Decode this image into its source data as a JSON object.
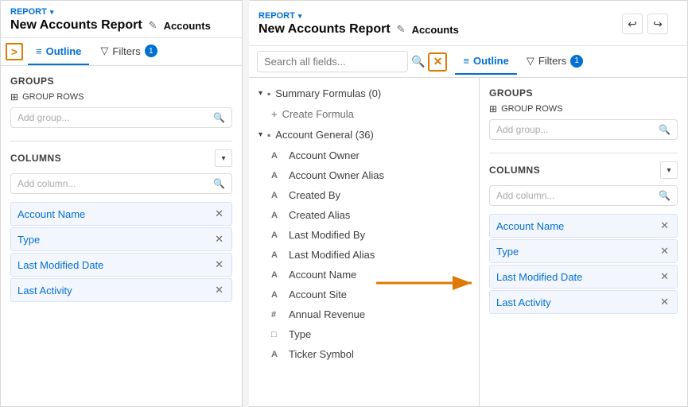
{
  "left": {
    "report_label": "REPORT",
    "title": "New Accounts Report",
    "accounts": "Accounts",
    "tabs": {
      "outline": "Outline",
      "filters": "Filters",
      "filters_count": "1"
    },
    "expand_icon": ">",
    "groups": {
      "title": "Groups",
      "group_rows_label": "GROUP ROWS",
      "placeholder": "Add group..."
    },
    "columns": {
      "title": "Columns",
      "placeholder": "Add column...",
      "items": [
        {
          "label": "Account Name"
        },
        {
          "label": "Type"
        },
        {
          "label": "Last Modified Date"
        },
        {
          "label": "Last Activity"
        }
      ]
    }
  },
  "right": {
    "report_label": "REPORT",
    "title": "New Accounts Report",
    "accounts": "Accounts",
    "search_placeholder": "Search all fields...",
    "undo": "↩",
    "redo": "↪",
    "tabs": {
      "outline": "Outline",
      "filters": "Filters",
      "filters_count": "1"
    },
    "field_list": {
      "summary_formulas": "Summary Formulas (0)",
      "create_formula": "Create Formula",
      "account_general": "Account General (36)",
      "fields": [
        {
          "type": "A",
          "name": "Account Owner"
        },
        {
          "type": "A",
          "name": "Account Owner Alias"
        },
        {
          "type": "A",
          "name": "Created By"
        },
        {
          "type": "A",
          "name": "Created Alias"
        },
        {
          "type": "A",
          "name": "Last Modified By"
        },
        {
          "type": "A",
          "name": "Last Modified Alias"
        },
        {
          "type": "A",
          "name": "Account Name"
        },
        {
          "type": "A",
          "name": "Account Site"
        },
        {
          "type": "#",
          "name": "Annual Revenue"
        },
        {
          "type": "□",
          "name": "Type"
        },
        {
          "type": "A",
          "name": "Ticker Symbol"
        }
      ]
    },
    "groups": {
      "title": "Groups",
      "group_rows_label": "GROUP ROWS",
      "placeholder": "Add group..."
    },
    "columns": {
      "title": "Columns",
      "placeholder": "Add column...",
      "items": [
        {
          "label": "Account Name"
        },
        {
          "label": "Type"
        },
        {
          "label": "Last Modified Date"
        },
        {
          "label": "Last Activity"
        }
      ]
    }
  },
  "icons": {
    "search": "🔍",
    "close": "✕",
    "filter": "▼",
    "outline": "≡",
    "pencil": "✎",
    "folder": "📁",
    "table": "⊞",
    "chevron_down": "▾",
    "plus": "+"
  }
}
